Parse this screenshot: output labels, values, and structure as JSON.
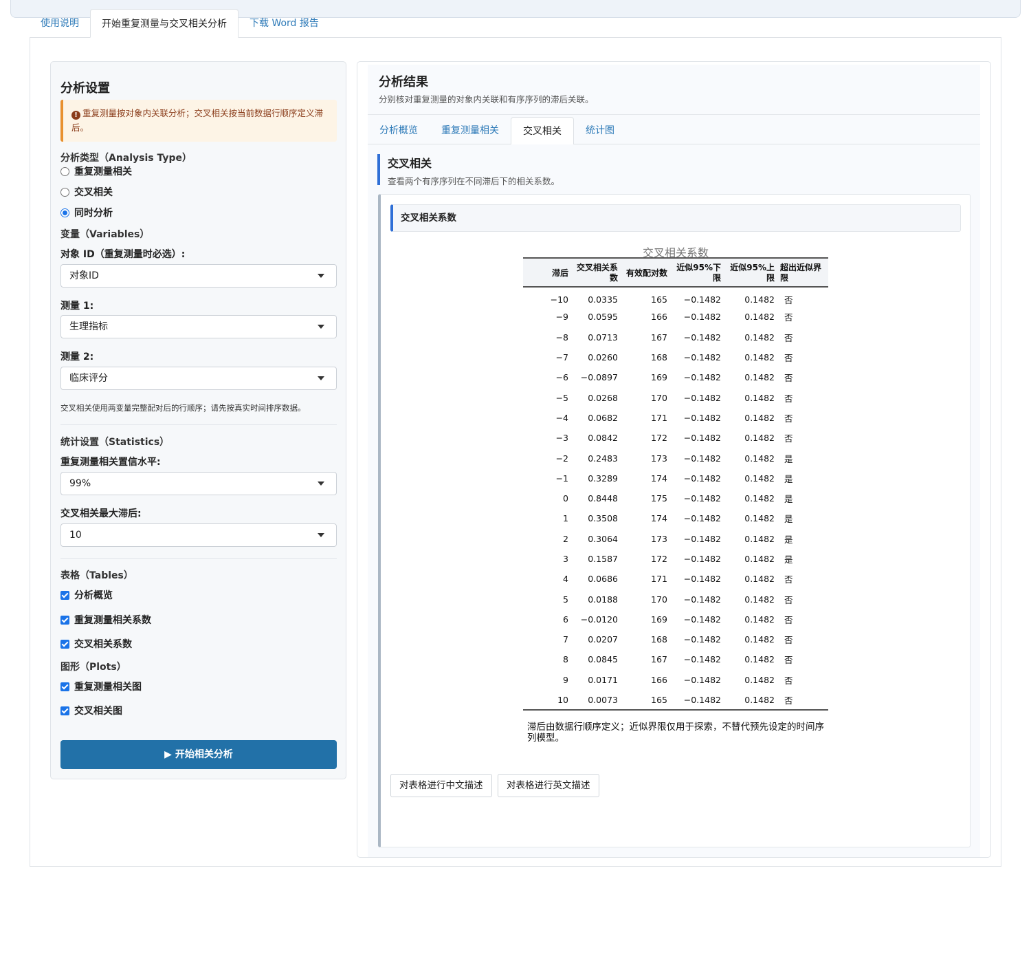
{
  "main_tabs": [
    {
      "label": "使用说明"
    },
    {
      "label": "开始重复测量与交叉相关分析"
    },
    {
      "label": "下载 Word 报告"
    }
  ],
  "settings": {
    "title": "分析设置",
    "warning": "重复测量按对象内关联分析；交叉相关按当前数据行顺序定义滞后。",
    "analysis_type_label": "分析类型（Analysis Type）",
    "analysis_types": [
      {
        "label": "重复测量相关",
        "selected": false
      },
      {
        "label": "交叉相关",
        "selected": false
      },
      {
        "label": "同时分析",
        "selected": true
      }
    ],
    "variables_label": "变量（Variables）",
    "subject_id_label": "对象 ID（重复测量时必选）:",
    "subject_id_value": "对象ID",
    "measure1_label": "测量 1:",
    "measure1_value": "生理指标",
    "measure2_label": "测量 2:",
    "measure2_value": "临床评分",
    "variables_hint": "交叉相关使用两变量完整配对后的行顺序；请先按真实时间排序数据。",
    "statistics_label": "统计设置（Statistics）",
    "conf_level_label": "重复测量相关置信水平:",
    "conf_level_value": "99%",
    "max_lag_label": "交叉相关最大滞后:",
    "max_lag_value": "10",
    "tables_label": "表格（Tables）",
    "tables": [
      {
        "label": "分析概览",
        "checked": true
      },
      {
        "label": "重复测量相关系数",
        "checked": true
      },
      {
        "label": "交叉相关系数",
        "checked": true
      }
    ],
    "plots_label": "图形（Plots）",
    "plots": [
      {
        "label": "重复测量相关图",
        "checked": true
      },
      {
        "label": "交叉相关图",
        "checked": true
      }
    ],
    "run_button": "开始相关分析"
  },
  "results": {
    "title": "分析结果",
    "subtitle": "分别核对重复测量的对象内关联和有序序列的滞后关联。",
    "tabs": [
      {
        "label": "分析概览"
      },
      {
        "label": "重复测量相关"
      },
      {
        "label": "交叉相关"
      },
      {
        "label": "统计图"
      }
    ],
    "active_tab": "交叉相关",
    "section_title": "交叉相关",
    "section_subtitle": "查看两个有序序列在不同滞后下的相关系数。",
    "card_title": "交叉相关系数",
    "table": {
      "caption": "交叉相关系数",
      "headers": [
        "滞后",
        "交叉相关系数",
        "有效配对数",
        "近似95%下限",
        "近似95%上限",
        "超出近似界限"
      ],
      "rows": [
        [
          "−10",
          "0.0335",
          "165",
          "−0.1482",
          "0.1482",
          "否"
        ],
        [
          "−9",
          "0.0595",
          "166",
          "−0.1482",
          "0.1482",
          "否"
        ],
        [
          "−8",
          "0.0713",
          "167",
          "−0.1482",
          "0.1482",
          "否"
        ],
        [
          "−7",
          "0.0260",
          "168",
          "−0.1482",
          "0.1482",
          "否"
        ],
        [
          "−6",
          "−0.0897",
          "169",
          "−0.1482",
          "0.1482",
          "否"
        ],
        [
          "−5",
          "0.0268",
          "170",
          "−0.1482",
          "0.1482",
          "否"
        ],
        [
          "−4",
          "0.0682",
          "171",
          "−0.1482",
          "0.1482",
          "否"
        ],
        [
          "−3",
          "0.0842",
          "172",
          "−0.1482",
          "0.1482",
          "否"
        ],
        [
          "−2",
          "0.2483",
          "173",
          "−0.1482",
          "0.1482",
          "是"
        ],
        [
          "−1",
          "0.3289",
          "174",
          "−0.1482",
          "0.1482",
          "是"
        ],
        [
          "0",
          "0.8448",
          "175",
          "−0.1482",
          "0.1482",
          "是"
        ],
        [
          "1",
          "0.3508",
          "174",
          "−0.1482",
          "0.1482",
          "是"
        ],
        [
          "2",
          "0.3064",
          "173",
          "−0.1482",
          "0.1482",
          "是"
        ],
        [
          "3",
          "0.1587",
          "172",
          "−0.1482",
          "0.1482",
          "是"
        ],
        [
          "4",
          "0.0686",
          "171",
          "−0.1482",
          "0.1482",
          "否"
        ],
        [
          "5",
          "0.0188",
          "170",
          "−0.1482",
          "0.1482",
          "否"
        ],
        [
          "6",
          "−0.0120",
          "169",
          "−0.1482",
          "0.1482",
          "否"
        ],
        [
          "7",
          "0.0207",
          "168",
          "−0.1482",
          "0.1482",
          "否"
        ],
        [
          "8",
          "0.0845",
          "167",
          "−0.1482",
          "0.1482",
          "否"
        ],
        [
          "9",
          "0.0171",
          "166",
          "−0.1482",
          "0.1482",
          "否"
        ],
        [
          "10",
          "0.0073",
          "165",
          "−0.1482",
          "0.1482",
          "否"
        ]
      ],
      "note": "滞后由数据行顺序定义；近似界限仅用于探索，不替代预先设定的时间序列模型。"
    },
    "describe_zh_button": "对表格进行中文描述",
    "describe_en_button": "对表格进行英文描述"
  }
}
